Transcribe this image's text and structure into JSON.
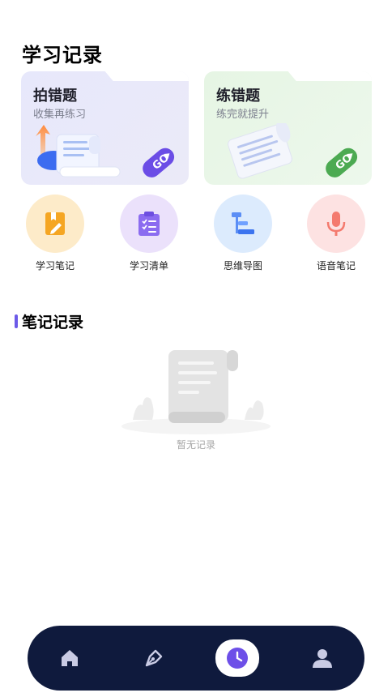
{
  "header": {
    "title": "学习记录"
  },
  "cards": [
    {
      "title": "拍错题",
      "subtitle": "收集再练习",
      "badge": "GO",
      "accent": "#6b4de6"
    },
    {
      "title": "练错题",
      "subtitle": "练完就提升",
      "badge": "GO",
      "accent": "#4caa52"
    }
  ],
  "quick_actions": [
    {
      "label": "学习笔记",
      "icon": "notebook-pen-icon",
      "bg": "#fdebc9"
    },
    {
      "label": "学习清单",
      "icon": "clipboard-checklist-icon",
      "bg": "#ebe1fb"
    },
    {
      "label": "思维导图",
      "icon": "mind-map-icon",
      "bg": "#dcebfd"
    },
    {
      "label": "语音笔记",
      "icon": "microphone-icon",
      "bg": "#fde2e2"
    }
  ],
  "notes_section": {
    "title": "笔记记录",
    "empty_text": "暂无记录"
  },
  "tabbar": {
    "items": [
      {
        "name": "home",
        "icon": "home-icon"
      },
      {
        "name": "pen",
        "icon": "fountain-pen-icon"
      },
      {
        "name": "record",
        "icon": "clock-icon",
        "active": true
      },
      {
        "name": "profile",
        "icon": "user-icon"
      }
    ]
  }
}
